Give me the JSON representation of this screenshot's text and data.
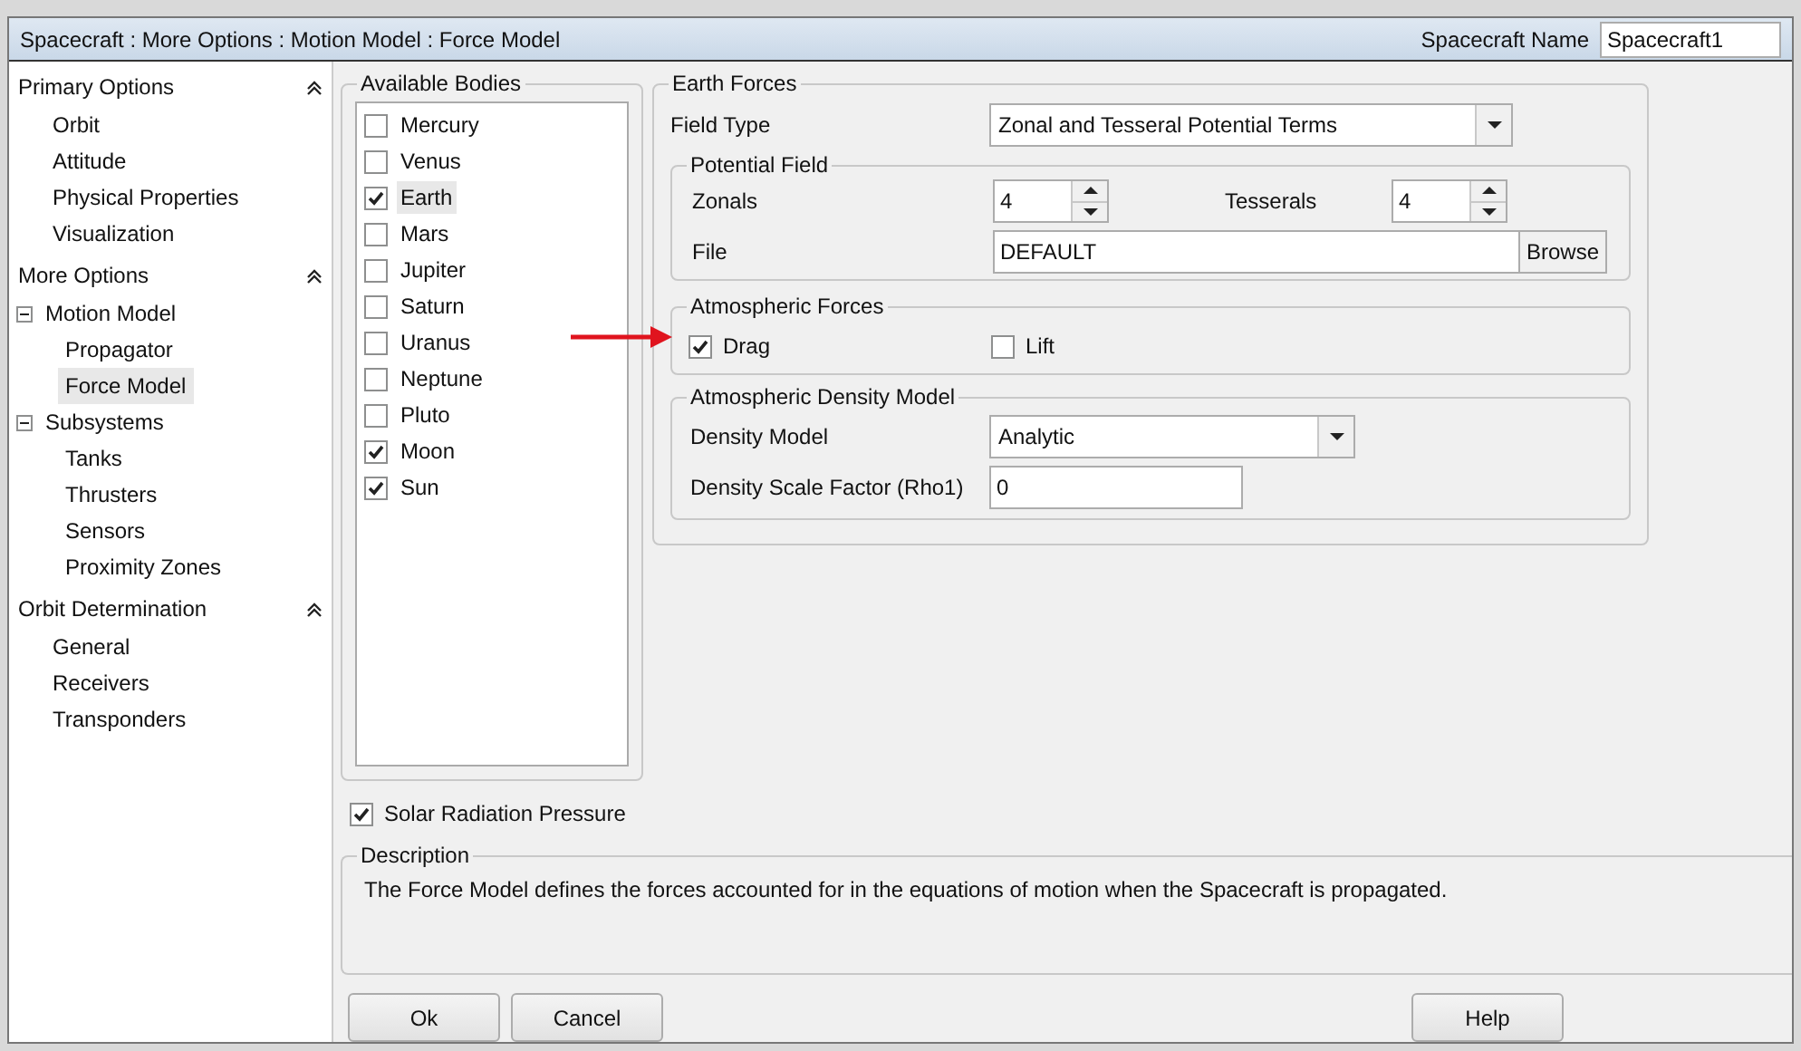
{
  "window": {
    "title": "Spacecraft : More Options : Motion Model : Force Model",
    "name_label": "Spacecraft Name",
    "name_value": "Spacecraft1"
  },
  "sidebar": {
    "sections": [
      {
        "title": "Primary Options",
        "expanded": true,
        "items": [
          {
            "label": "Orbit",
            "selected": false
          },
          {
            "label": "Attitude",
            "selected": false
          },
          {
            "label": "Physical Properties",
            "selected": false
          },
          {
            "label": "Visualization",
            "selected": false
          }
        ]
      },
      {
        "title": "More Options",
        "expanded": true,
        "items": [
          {
            "label": "Motion Model",
            "selected": false,
            "expanded": true,
            "children": [
              {
                "label": "Propagator",
                "selected": false
              },
              {
                "label": "Force Model",
                "selected": true
              }
            ]
          },
          {
            "label": "Subsystems",
            "selected": false,
            "expanded": true,
            "children": [
              {
                "label": "Tanks",
                "selected": false
              },
              {
                "label": "Thrusters",
                "selected": false
              },
              {
                "label": "Sensors",
                "selected": false
              },
              {
                "label": "Proximity Zones",
                "selected": false
              }
            ]
          }
        ]
      },
      {
        "title": "Orbit Determination",
        "expanded": true,
        "items": [
          {
            "label": "General",
            "selected": false
          },
          {
            "label": "Receivers",
            "selected": false
          },
          {
            "label": "Transponders",
            "selected": false
          }
        ]
      }
    ]
  },
  "available_bodies": {
    "title": "Available Bodies",
    "items": [
      {
        "label": "Mercury",
        "checked": false,
        "selected": false
      },
      {
        "label": "Venus",
        "checked": false,
        "selected": false
      },
      {
        "label": "Earth",
        "checked": true,
        "selected": true
      },
      {
        "label": "Mars",
        "checked": false,
        "selected": false
      },
      {
        "label": "Jupiter",
        "checked": false,
        "selected": false
      },
      {
        "label": "Saturn",
        "checked": false,
        "selected": false
      },
      {
        "label": "Uranus",
        "checked": false,
        "selected": false
      },
      {
        "label": "Neptune",
        "checked": false,
        "selected": false
      },
      {
        "label": "Pluto",
        "checked": false,
        "selected": false
      },
      {
        "label": "Moon",
        "checked": true,
        "selected": false
      },
      {
        "label": "Sun",
        "checked": true,
        "selected": false
      }
    ]
  },
  "earth_forces": {
    "title": "Earth Forces",
    "field_type_label": "Field Type",
    "field_type_value": "Zonal and Tesseral Potential Terms",
    "potential_field": {
      "title": "Potential Field",
      "zonals_label": "Zonals",
      "zonals_value": "4",
      "tesserals_label": "Tesserals",
      "tesserals_value": "4",
      "file_label": "File",
      "file_value": "DEFAULT",
      "browse": "Browse"
    },
    "atmospheric_forces": {
      "title": "Atmospheric Forces",
      "options": [
        {
          "label": "Drag",
          "checked": true
        },
        {
          "label": "Lift",
          "checked": false
        }
      ]
    },
    "density": {
      "title": "Atmospheric Density Model",
      "model_label": "Density Model",
      "model_value": "Analytic",
      "scale_label": "Density Scale Factor (Rho1)",
      "scale_value": "0"
    }
  },
  "solar_radiation": {
    "label": "Solar Radiation Pressure",
    "checked": true
  },
  "description": {
    "title": "Description",
    "text": "The Force Model defines the forces accounted for in the equations of motion when the Spacecraft is propagated."
  },
  "buttons": [
    {
      "label": "Ok"
    },
    {
      "label": "Cancel"
    }
  ],
  "help_button": "Help"
}
